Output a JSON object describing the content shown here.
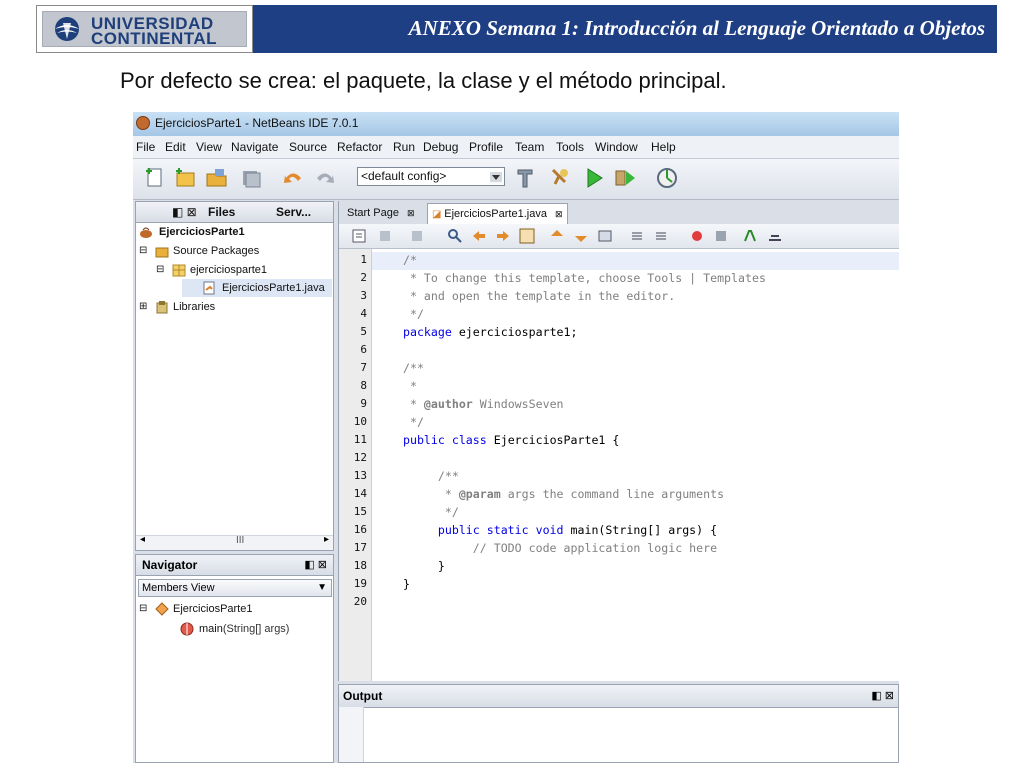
{
  "slide": {
    "logo_line1": "UNIVERSIDAD",
    "logo_line2": "CONTINENTAL",
    "header_title": "ANEXO Semana 1: Introducción al Lenguaje Orientado a Objetos",
    "subtitle": "Por defecto se crea: el paquete, la clase y el método principal.",
    "colors": {
      "header_bar": "#1f3f85",
      "logo_text": "#1f3f7a"
    }
  },
  "ide": {
    "window_title": "EjerciciosParte1 - NetBeans IDE 7.0.1",
    "menu": [
      "File",
      "Edit",
      "View",
      "Navigate",
      "Source",
      "Refactor",
      "Run",
      "Debug",
      "Profile",
      "Team",
      "Tools",
      "Window",
      "Help"
    ],
    "toolbar": {
      "config_value": "<default config>",
      "icons": [
        "new-file-icon",
        "new-project-icon",
        "open-project-icon",
        "save-all-icon",
        "undo-icon",
        "redo-icon",
        "build-icon",
        "clean-build-icon",
        "run-icon",
        "debug-icon",
        "profile-icon"
      ]
    },
    "projects_panel": {
      "tabs": [
        "",
        "Files",
        "Serv..."
      ],
      "tree": [
        {
          "label": "EjerciciosParte1",
          "icon": "project-icon",
          "bold": true
        },
        {
          "label": "Source Packages",
          "icon": "source-folder-icon"
        },
        {
          "label": "ejerciciosparte1",
          "icon": "package-icon"
        },
        {
          "label": "EjerciciosParte1.java",
          "icon": "java-file-icon",
          "selected": true
        },
        {
          "label": "Libraries",
          "icon": "libraries-icon"
        }
      ],
      "scroll_thumb": "III"
    },
    "navigator": {
      "title": "Navigator",
      "view": "Members View",
      "class_name": "EjerciciosParte1",
      "method_name": "main",
      "method_params": "(String[] args)"
    },
    "editor": {
      "tabs": [
        "Start Page",
        "EjerciciosParte1.java"
      ],
      "active_tab": 1,
      "line_numbers": [
        "1",
        "2",
        "3",
        "4",
        "5",
        "6",
        "7",
        "8",
        "9",
        "10",
        "11",
        "12",
        "13",
        "14",
        "15",
        "16",
        "17",
        "18",
        "19",
        "20"
      ],
      "code_lines": [
        [
          {
            "t": " /*",
            "c": "#808080"
          }
        ],
        [
          {
            "t": "  * To change this template, choose Tools | Templates",
            "c": "#808080"
          }
        ],
        [
          {
            "t": "  * and open the template in the editor.",
            "c": "#808080"
          }
        ],
        [
          {
            "t": "  */",
            "c": "#808080"
          }
        ],
        [
          {
            "t": " package",
            "c": "#0000e6"
          },
          {
            "t": " ejerciciosparte1;",
            "c": "#000000"
          }
        ],
        [
          {
            "t": "",
            "c": "#000000"
          }
        ],
        [
          {
            "t": " /**",
            "c": "#808080"
          }
        ],
        [
          {
            "t": "  *",
            "c": "#808080"
          }
        ],
        [
          {
            "t": "  * ",
            "c": "#808080"
          },
          {
            "t": "@author",
            "c": "#808080",
            "b": true
          },
          {
            "t": " WindowsSeven",
            "c": "#808080"
          }
        ],
        [
          {
            "t": "  */",
            "c": "#808080"
          }
        ],
        [
          {
            "t": " public class",
            "c": "#0000e6"
          },
          {
            "t": " EjerciciosParte1 {",
            "c": "#000000"
          }
        ],
        [
          {
            "t": "",
            "c": "#000000"
          }
        ],
        [
          {
            "t": "      /**",
            "c": "#808080"
          }
        ],
        [
          {
            "t": "       * ",
            "c": "#808080"
          },
          {
            "t": "@param",
            "c": "#808080",
            "b": true
          },
          {
            "t": " args the command line arguments",
            "c": "#808080"
          }
        ],
        [
          {
            "t": "       */",
            "c": "#808080"
          }
        ],
        [
          {
            "t": "      public static void",
            "c": "#0000e6"
          },
          {
            "t": " main(String[] args) {",
            "c": "#000000"
          }
        ],
        [
          {
            "t": "           // TODO code application logic here",
            "c": "#808080"
          }
        ],
        [
          {
            "t": "      }",
            "c": "#000000"
          }
        ],
        [
          {
            "t": " }",
            "c": "#000000"
          }
        ],
        [
          {
            "t": "",
            "c": "#000000"
          }
        ]
      ]
    },
    "output": {
      "title": "Output"
    }
  }
}
